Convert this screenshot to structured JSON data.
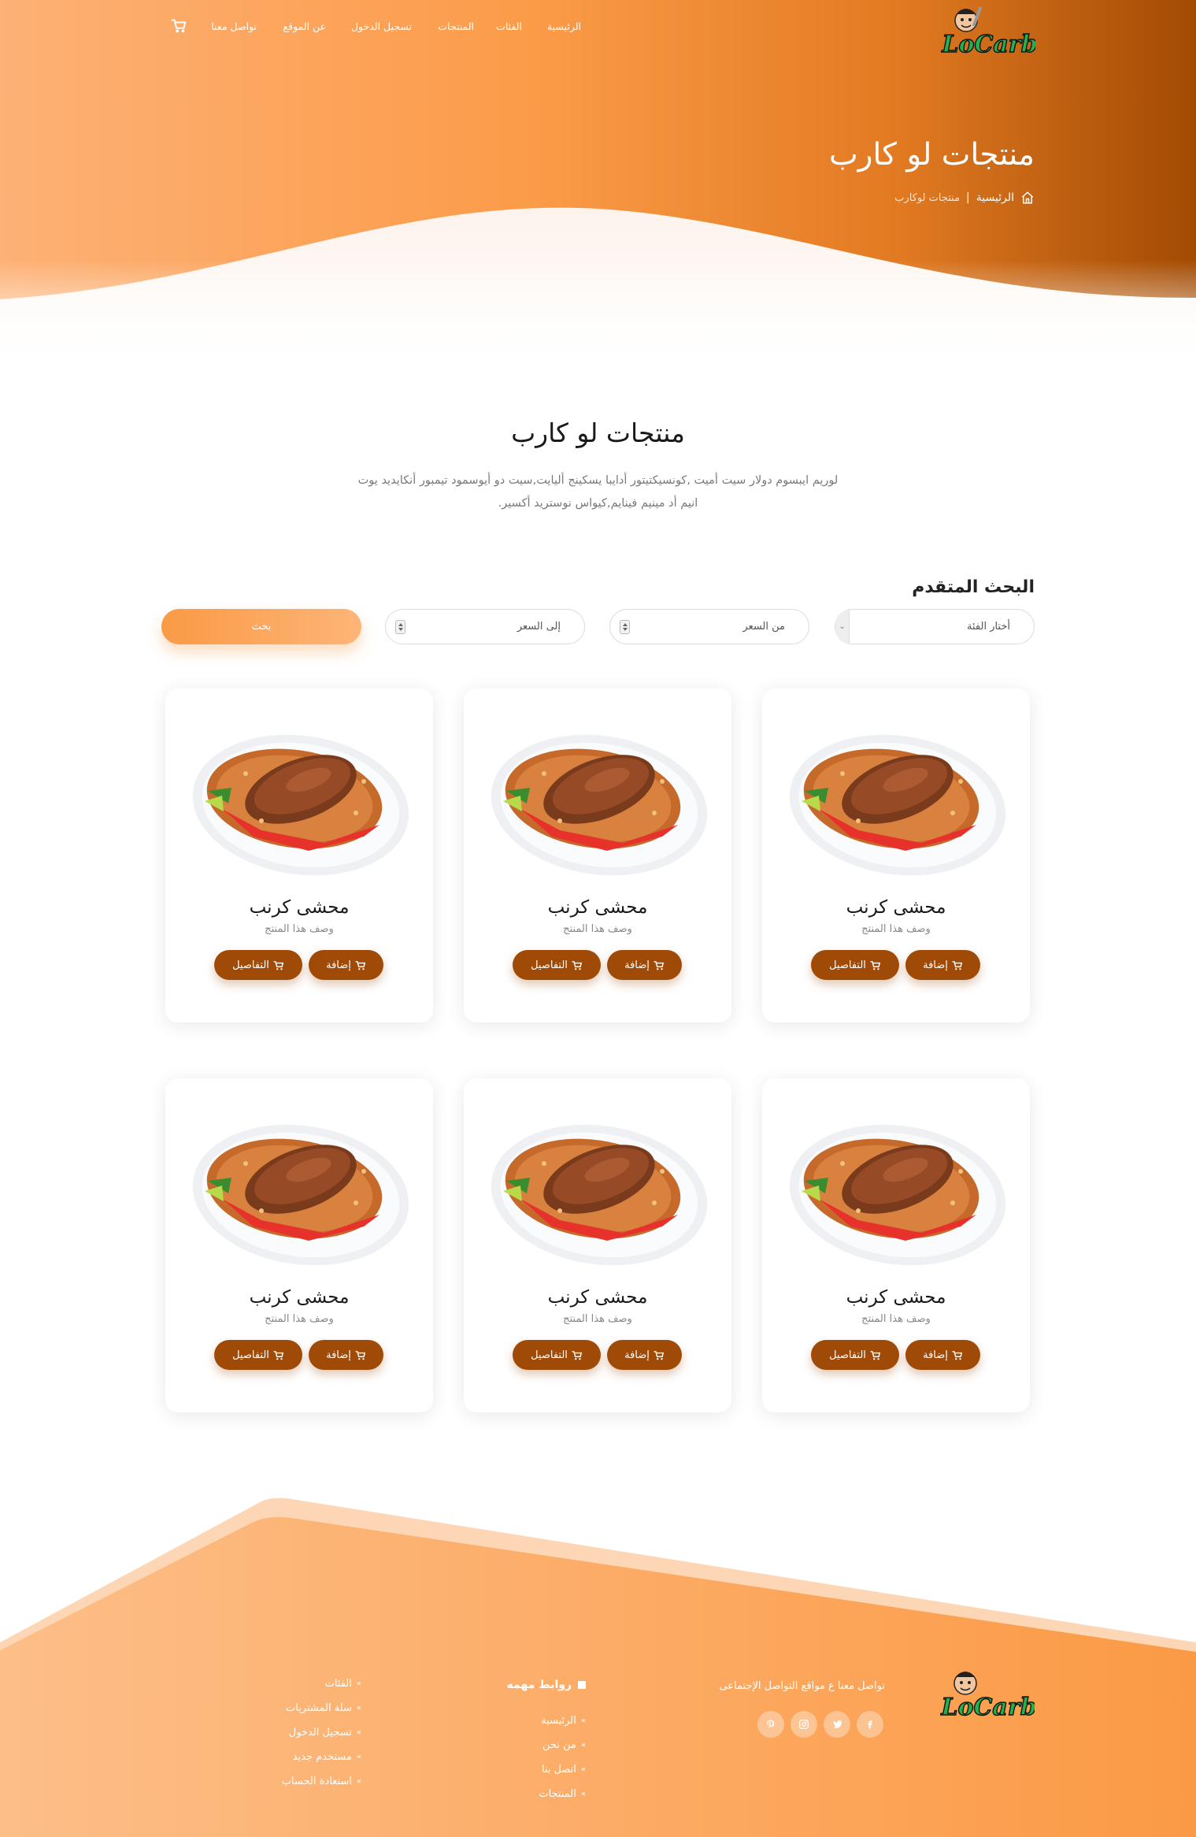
{
  "brand": {
    "logo_text": "LoCarb"
  },
  "nav": {
    "items": [
      {
        "label": "الرئيسية"
      },
      {
        "label": "الفئات"
      },
      {
        "label": "المنتجات"
      },
      {
        "label": "تسجيل الدخول"
      },
      {
        "label": "عن الموقع"
      },
      {
        "label": "تواصل معنا"
      }
    ],
    "cart_icon": "cart-icon"
  },
  "hero": {
    "title": "منتجات لو كارب",
    "breadcrumb": {
      "home": "الرئيسية",
      "separator": "|",
      "current": "منتجات لوكارب"
    }
  },
  "section": {
    "title": "منتجات لو كارب",
    "description": "لوريم ايبسوم دولار سيت أميت ,كونسيكتيتور أدايبا يسكينج أليايت,سيت دو أيوسمود تيمبور أنكايديد يوت انيم أد مينيم فينايم,كيواس نوستريد أكسير."
  },
  "search": {
    "title": "البحث المتقدم",
    "category_label": "أختار الفئة",
    "price_from_label": "من السعر",
    "price_to_label": "إلى السعر",
    "button_label": "بحث"
  },
  "products": [
    {
      "name": "محشى كرنب",
      "desc": "وصف هذا المنتج",
      "add_label": "إضافة",
      "details_label": "التفاصيل"
    },
    {
      "name": "محشى كرنب",
      "desc": "وصف هذا المنتج",
      "add_label": "إضافة",
      "details_label": "التفاصيل"
    },
    {
      "name": "محشى كرنب",
      "desc": "وصف هذا المنتج",
      "add_label": "إضافة",
      "details_label": "التفاصيل"
    },
    {
      "name": "محشى كرنب",
      "desc": "وصف هذا المنتج",
      "add_label": "إضافة",
      "details_label": "التفاصيل"
    },
    {
      "name": "محشى كرنب",
      "desc": "وصف هذا المنتج",
      "add_label": "إضافة",
      "details_label": "التفاصيل"
    },
    {
      "name": "محشى كرنب",
      "desc": "وصف هذا المنتج",
      "add_label": "إضافة",
      "details_label": "التفاصيل"
    }
  ],
  "footer": {
    "contact_text": "تواصل معنا ع مواقع التواصل الإجتماعى",
    "social_icons": [
      "facebook-icon",
      "twitter-icon",
      "instagram-icon",
      "pinterest-icon"
    ],
    "links_heading": "روابط مهمه",
    "links_col1": [
      "الرئيسية",
      "من نحن",
      "اتصل بنا",
      "المنتجات"
    ],
    "links_col2": [
      "الفئات",
      "سلة المشتريات",
      "تسجيل الدخول",
      "مستخدم جديد",
      "استعادة الحساب"
    ]
  },
  "colors": {
    "primary_orange": "#fa9a45",
    "dark_orange": "#a04a07",
    "text_dark": "#1a1a1a"
  }
}
